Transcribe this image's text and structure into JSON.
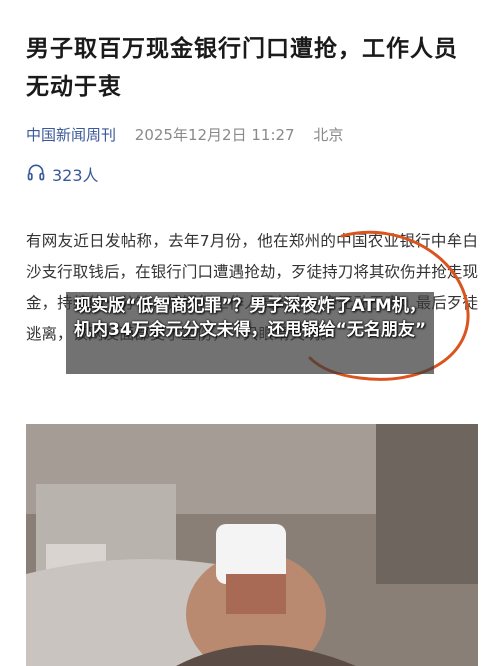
{
  "article": {
    "headline": "男子取百万现金银行门口遭抢，工作人员无动于衷",
    "source": "中国新闻周刊",
    "timestamp": "2025年12月2日 11:27",
    "location": "北京",
    "listen_count": "323人",
    "listen_icon": "headphones-icon",
    "body": "有网友近日发帖称，去年7月份，他在郑州的中国农业银行中牟白沙支行取钱后，在银行门口遭遇抢劫，歹徒持刀将其砍伤并抢走现金，持续约一分钟，该银行工作人员却在一旁无动于衷，最后歹徒逃离，该网友面部受了重伤，一只眼睛失明。"
  },
  "overlay": {
    "caption": "现实版“低智商犯罪”？男子深夜炸了ATM机，机内34万余元分文未得，还甩锅给“无名朋友”"
  },
  "colors": {
    "source_blue": "#3b5998",
    "annotation_circle": "#d9541e"
  }
}
